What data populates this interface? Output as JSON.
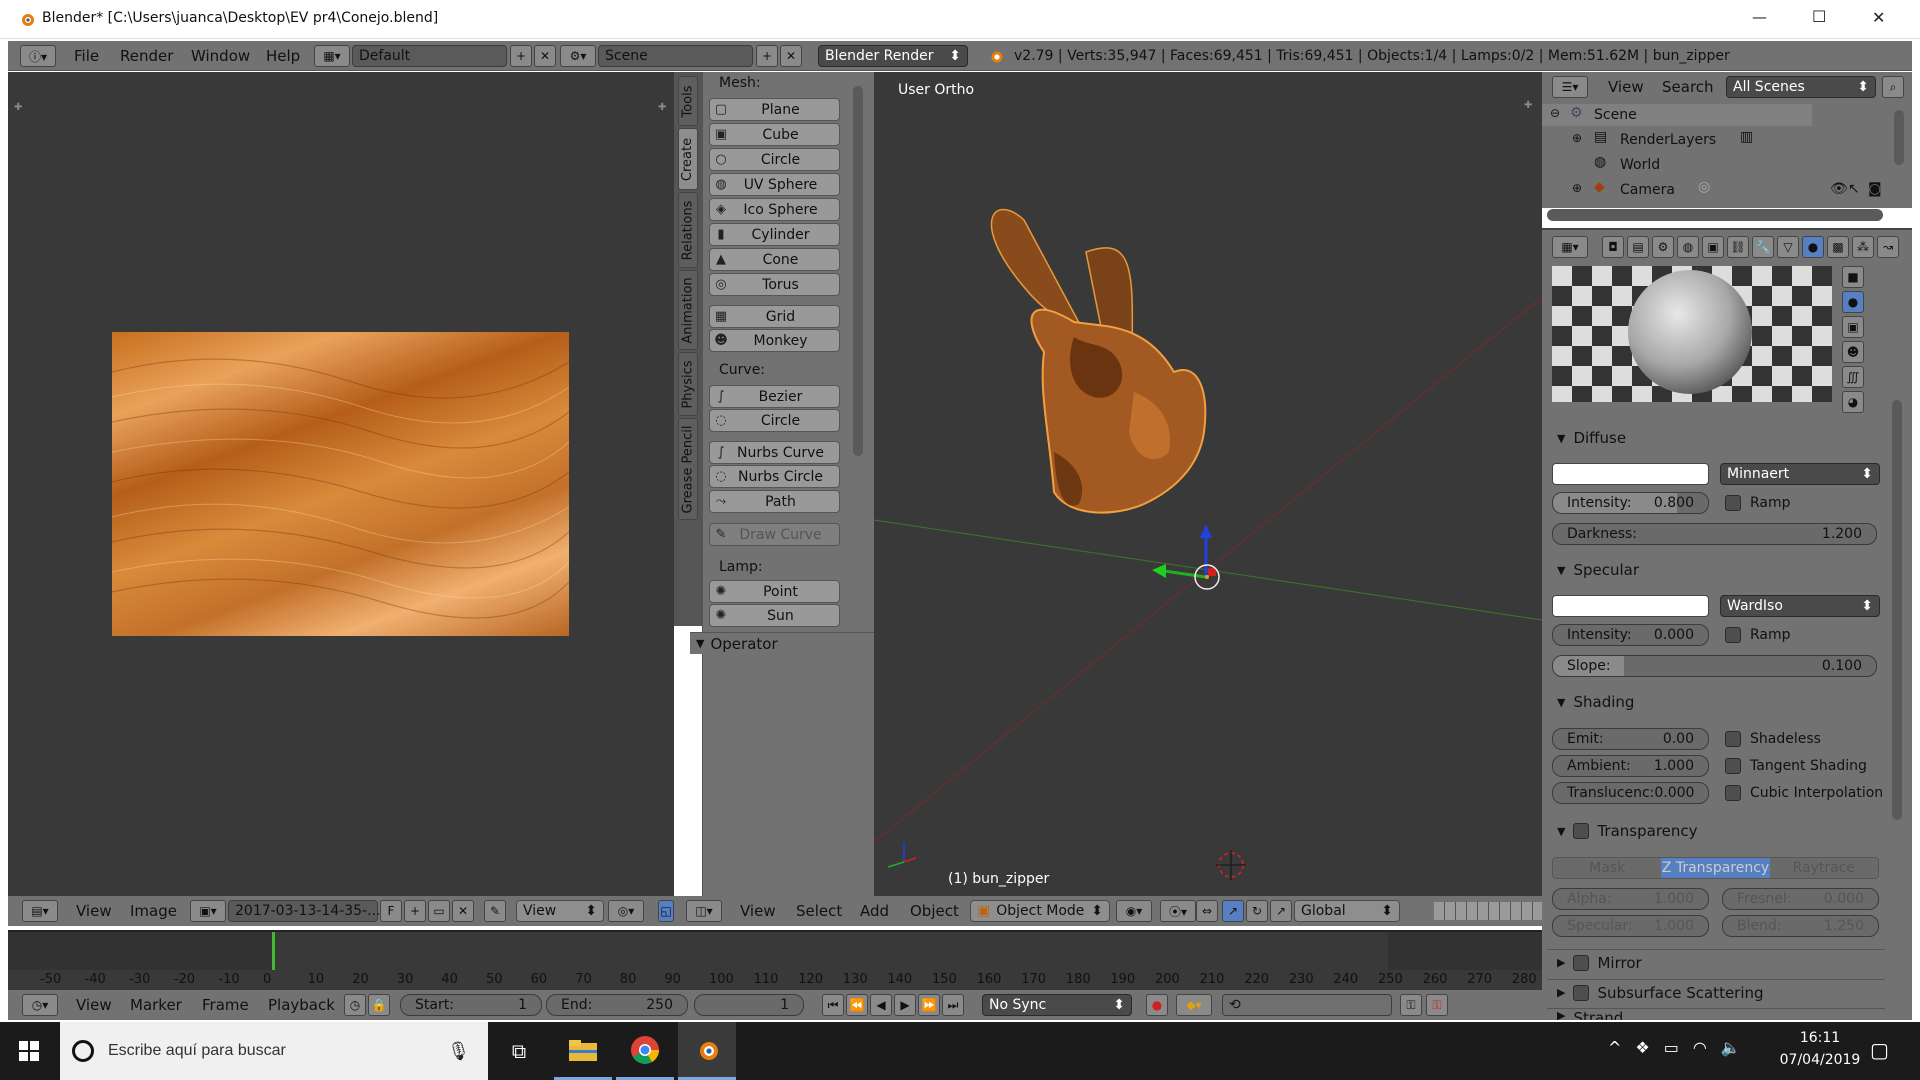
{
  "window": {
    "title": "Blender* [C:\\Users\\juanca\\Desktop\\EV pr4\\Conejo.blend]",
    "minimize": "—",
    "maximize": "☐",
    "close": "✕"
  },
  "top_menu": {
    "items": [
      "File",
      "Render",
      "Window",
      "Help"
    ],
    "layout": "Default",
    "scene": "Scene",
    "engine": "Blender Render",
    "stats": "v2.79 | Verts:35,947 | Faces:69,451 | Tris:69,451 | Objects:1/4 | Lamps:0/2 | Mem:51.62M | bun_zipper"
  },
  "image_editor": {
    "menus": [
      "View",
      "Image"
    ],
    "image_name": "2017-03-13-14-35-...",
    "fake_user": "F",
    "view_label": "View"
  },
  "tool_shelf": {
    "tabs": [
      "Tools",
      "Create",
      "Relations",
      "Animation",
      "Physics",
      "Grease Pencil"
    ],
    "mesh_label": "Mesh:",
    "mesh": [
      "Plane",
      "Cube",
      "Circle",
      "UV Sphere",
      "Ico Sphere",
      "Cylinder",
      "Cone",
      "Torus",
      "Grid",
      "Monkey"
    ],
    "curve_label": "Curve:",
    "curve": [
      "Bezier",
      "Circle",
      "Nurbs Curve",
      "Nurbs Circle",
      "Path"
    ],
    "draw_curve": "Draw Curve",
    "lamp_label": "Lamp:",
    "lamp": [
      "Point",
      "Sun"
    ],
    "operator": "Operator"
  },
  "viewport": {
    "view_name": "User Ortho",
    "object_label": "(1) bun_zipper",
    "menus": [
      "View",
      "Select",
      "Add",
      "Object"
    ],
    "mode": "Object Mode",
    "orientation": "Global"
  },
  "outliner": {
    "menus": [
      "View",
      "Search"
    ],
    "filter": "All Scenes",
    "tree": [
      "Scene",
      "RenderLayers",
      "World",
      "Camera"
    ]
  },
  "properties": {
    "diffuse": {
      "title": "Diffuse",
      "shader": "Minnaert",
      "intensity_label": "Intensity:",
      "intensity": "0.800",
      "ramp": "Ramp",
      "darkness_label": "Darkness:",
      "darkness": "1.200"
    },
    "specular": {
      "title": "Specular",
      "shader": "WardIso",
      "intensity_label": "Intensity:",
      "intensity": "0.000",
      "ramp": "Ramp",
      "slope_label": "Slope:",
      "slope": "0.100"
    },
    "shading": {
      "title": "Shading",
      "emit_label": "Emit:",
      "emit": "0.00",
      "ambient_label": "Ambient:",
      "ambient": "1.000",
      "transluc_label": "Translucenc:",
      "transluc": "0.000",
      "shadeless": "Shadeless",
      "tangent": "Tangent Shading",
      "cubic": "Cubic Interpolation"
    },
    "transparency": {
      "title": "Transparency",
      "tabs": [
        "Mask",
        "Z Transparency",
        "Raytrace"
      ],
      "alpha_label": "Alpha:",
      "alpha": "1.000",
      "fresnel_label": "Fresnel:",
      "fresnel": "0.000",
      "specular_label": "Specular:",
      "specular": "1.000",
      "blend_label": "Blend:",
      "blend": "1.250"
    },
    "mirror": "Mirror",
    "sss": "Subsurface Scattering",
    "strand": "Strand"
  },
  "timeline": {
    "ticks": [
      "-50",
      "-40",
      "-30",
      "-20",
      "-10",
      "0",
      "10",
      "20",
      "30",
      "40",
      "50",
      "60",
      "70",
      "80",
      "90",
      "100",
      "110",
      "120",
      "130",
      "140",
      "150",
      "160",
      "170",
      "180",
      "190",
      "200",
      "210",
      "220",
      "230",
      "240",
      "250",
      "260",
      "270",
      "280"
    ],
    "menus": [
      "View",
      "Marker",
      "Frame",
      "Playback"
    ],
    "start_label": "Start:",
    "start": "1",
    "end_label": "End:",
    "end": "250",
    "current": "1",
    "sync": "No Sync"
  },
  "taskbar": {
    "search": "Escribe aquí para buscar",
    "time": "16:11",
    "date": "07/04/2019"
  },
  "colors": {
    "accent": "#5680c2",
    "bg_dark": "#393939",
    "panel": "#727272",
    "fur": "#c8782c"
  }
}
